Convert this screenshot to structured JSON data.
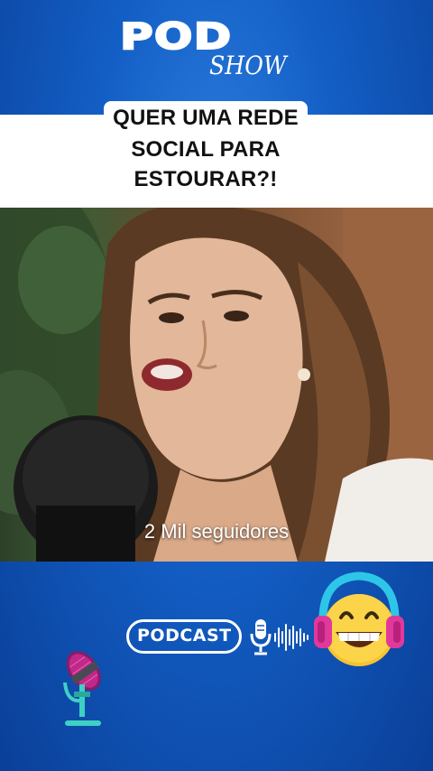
{
  "logo": {
    "pod": "POD",
    "show": "SHOW"
  },
  "headline": {
    "line1": "QUER UMA REDE",
    "line2": "SOCIAL PARA",
    "line3": "ESTOURAR?!"
  },
  "video": {
    "subtitle": "2 Mil seguidores"
  },
  "badge": {
    "label": "PODCAST"
  },
  "colors": {
    "background": "#135fc6",
    "band": "#ffffff",
    "accent_pink": "#e0399b",
    "accent_cyan": "#2ec6e8"
  }
}
